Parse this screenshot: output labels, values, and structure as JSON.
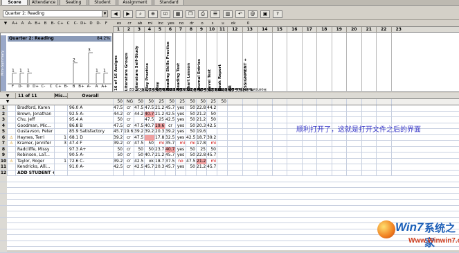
{
  "tabs": [
    "Score",
    "Attendance",
    "Seating",
    "Student",
    "Assignment",
    "Standard"
  ],
  "toolbar": {
    "period": "Quarter 2: Reading"
  },
  "letter_heads": [
    "A+",
    "A",
    "A-",
    "B+",
    "B",
    "B-",
    "C+",
    "C",
    "C-",
    "D+",
    "D",
    "D-",
    "F"
  ],
  "column_letters": [
    "ex",
    "cr",
    "ab",
    "mi",
    "inc",
    "yes",
    "no",
    "dr",
    "o",
    "s",
    "u",
    "ok",
    "0"
  ],
  "column_numbers": [
    "1",
    "2",
    "3",
    "4",
    "5",
    "6",
    "7",
    "8",
    "9",
    "10",
    "11",
    "12",
    "13",
    "14",
    "15",
    "16",
    "17",
    "18",
    "19",
    "20",
    "21",
    "22",
    "23"
  ],
  "chart": {
    "title": "Quarter 2: Reading",
    "percent": "84.2%",
    "side_label": "Mini-Summary",
    "bar_labels": [
      "F",
      "D-",
      "D",
      "D+",
      "C-",
      "C",
      "C+",
      "B-",
      "B",
      "B+",
      "A-",
      "A",
      "A+"
    ],
    "bar_values": [
      1,
      1,
      1,
      0,
      0,
      0,
      0,
      0,
      2,
      0,
      3,
      1,
      1
    ]
  },
  "assignments": [
    {
      "name": "16 of 16 Assigns",
      "detail": ""
    },
    {
      "name": "Literature Groups",
      "detail": "Classwork 2006-11-02"
    },
    {
      "name": "Literature Self-Study",
      "detail": "Classwork 2006-11-05"
    },
    {
      "name": "Play Practice",
      "detail": "Classwork 2006-11-09"
    },
    {
      "name": "Play",
      "detail": "Test-Quiz 2006-11-16"
    },
    {
      "name": "Reading Skills Practice",
      "detail": "Classwork 2006-11-19"
    },
    {
      "name": "Reading Test",
      "detail": "Test-Quiz 2006-11-20"
    },
    {
      "name": "Chart Lesson",
      "detail": "Classwork 2006-11-30"
    },
    {
      "name": "Journal Entries",
      "detail": "Classwork 2006-12-04"
    },
    {
      "name": "Level Test",
      "detail": "Test-Quiz 2006-12-11"
    },
    {
      "name": "Book Report",
      "detail": "Homework 2006-12-14"
    },
    {
      "name": "AR",
      "detail": ""
    },
    {
      "name": "ASSIGNMENT +",
      "detail": ""
    }
  ],
  "header": {
    "students": "11 of 11 Stud...",
    "missing": "Mis...",
    "overall": "Overall"
  },
  "max_points": [
    "50",
    "NG",
    "50",
    "50",
    "25",
    "50",
    "25",
    "50",
    "50",
    "25",
    "50"
  ],
  "students": [
    {
      "n": "1",
      "name": "Bradford, Karen",
      "mis": "",
      "overall": "96.0 A",
      "warn": "",
      "scores": [
        "47.5",
        "cr",
        "47.5",
        "47.5",
        "21.2",
        "45.7",
        "yes",
        "50",
        "22.8",
        "44.2"
      ]
    },
    {
      "n": "2",
      "name": "Brown, Jonathan",
      "mis": "",
      "overall": "92.5 A-",
      "warn": "",
      "scores": [
        "44.2",
        "cr",
        "44.2",
        "40.7",
        "21.2",
        "42.5",
        "yes",
        "50",
        "21.2",
        "50"
      ]
    },
    {
      "n": "3",
      "name": "Chu, Jeff",
      "mis": "",
      "overall": "95.4 A",
      "warn": "",
      "scores": [
        "50",
        "cr",
        "",
        "47.5",
        "25",
        "42.5",
        "yes",
        "50",
        "21.2",
        "50"
      ]
    },
    {
      "n": "4",
      "name": "Goodman, Mic...",
      "mis": "",
      "overall": "86.8 B",
      "warn": "",
      "scores": [
        "47.5",
        "cr",
        "47.5",
        "40.7",
        "19.6",
        "cr",
        "yes",
        "50",
        "20.3",
        "42.5"
      ]
    },
    {
      "n": "5",
      "name": "Gustavson, Peter",
      "mis": "",
      "overall": "85.9 Satisfactory",
      "warn": "",
      "scores": [
        "45.7",
        "19.6",
        "39.2",
        "39.2",
        "20.3",
        "39.2",
        "yes",
        "50",
        "19.6",
        ""
      ]
    },
    {
      "n": "6",
      "name": "Haynes, Terri",
      "mis": "1",
      "overall": "68.1 D",
      "warn": "!",
      "scores": [
        "39.2",
        "cr",
        "47.5",
        "",
        "17.8",
        "32.5",
        "yes",
        "42.5",
        "18.7",
        "39.2"
      ]
    },
    {
      "n": "7",
      "name": "Kramer, Jennifer",
      "mis": "3",
      "overall": "47.4 F",
      "warn": "!",
      "scores": [
        "39.2",
        "cr",
        "47.5",
        "50",
        "mi",
        "35.7",
        "mi",
        "mi",
        "17.8",
        "mi"
      ]
    },
    {
      "n": "8",
      "name": "Radcliffe, Missy",
      "mis": "",
      "overall": "97.3 A+",
      "warn": "",
      "scores": [
        "50",
        "cr",
        "50",
        "50",
        "23.7",
        "40.7",
        "yes",
        "50",
        "25",
        "50"
      ]
    },
    {
      "n": "9",
      "name": "Robinson, LaT...",
      "mis": "",
      "overall": "90.5 A-",
      "warn": "",
      "scores": [
        "50",
        "cr",
        "50",
        "40.7",
        "21.2",
        "45.7",
        "yes",
        "50",
        "22.8",
        "45.7"
      ]
    },
    {
      "n": "10",
      "name": "Taylor, Roger",
      "mis": "1",
      "overall": "72.6 C-",
      "warn": "!",
      "scores": [
        "39.2",
        "cr",
        "42.5",
        "ok",
        "18.7",
        "37.5",
        "no",
        "47.5",
        "21.2",
        "mi"
      ]
    },
    {
      "n": "11",
      "name": "Kendricks, Alli...",
      "mis": "",
      "overall": "91.0 A-",
      "warn": "",
      "scores": [
        "42.5",
        "cr",
        "42.5",
        "45.7",
        "20.3",
        "45.7",
        "yes",
        "50",
        "21.2",
        "45.7"
      ]
    },
    {
      "n": "12",
      "name": "ADD STUDENT +",
      "mis": "",
      "overall": "",
      "warn": "",
      "scores": []
    }
  ],
  "pink_cells": [
    [
      1,
      3
    ],
    [
      3,
      4
    ],
    [
      5,
      3
    ],
    [
      7,
      5
    ],
    [
      9,
      8
    ]
  ],
  "watermark": "顺利打开了，这就是打开文件之后的界面",
  "logo": {
    "brand": "Win7",
    "sys": "系统之家",
    "url": "Www.Winwin7.com"
  }
}
